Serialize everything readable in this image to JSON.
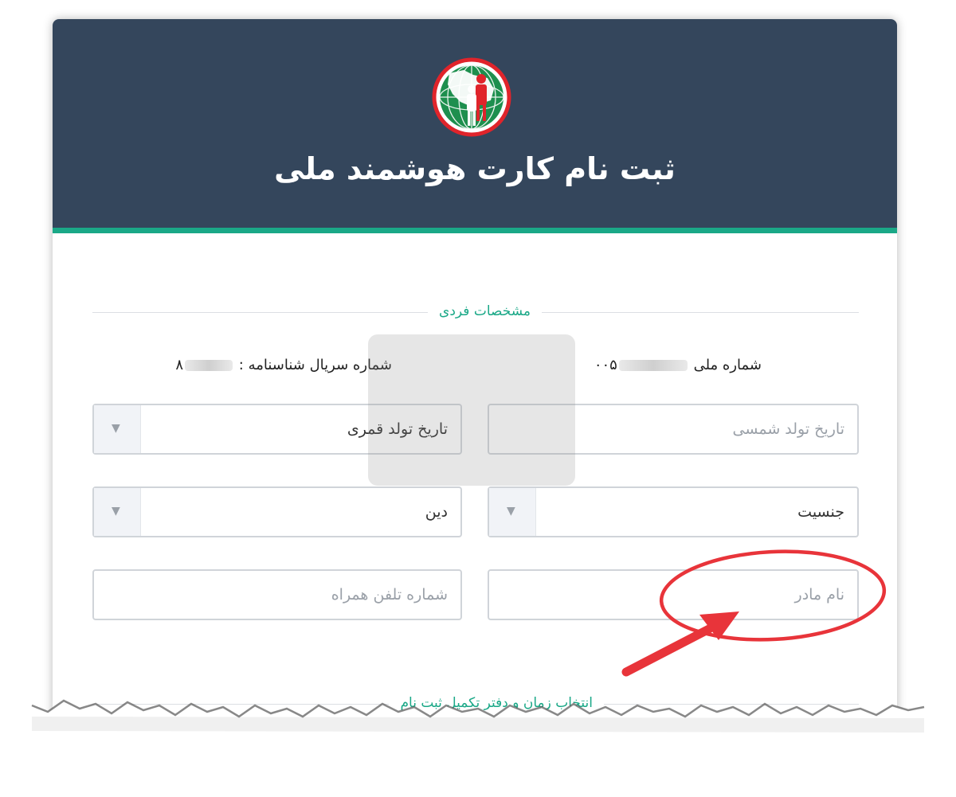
{
  "header": {
    "title": "ثبت نام کارت هوشمند ملی"
  },
  "section_personal": {
    "label": "مشخصات فردی",
    "national_code_label": "شماره ملی",
    "national_code_value": "۰۰۵",
    "serial_label": "شماره سریال شناسنامه :",
    "serial_value": "۸"
  },
  "fields": {
    "birth_shamsi_placeholder": "تاریخ تولد شمسی",
    "birth_qamari_label": "تاریخ تولد قمری",
    "gender_label": "جنسیت",
    "religion_label": "دین",
    "mother_name_placeholder": "نام مادر",
    "mobile_placeholder": "شماره تلفن همراه"
  },
  "section_schedule": {
    "label": "انتخاب زمان و دفتر تکمیل ثبت نام"
  },
  "colors": {
    "header_bg": "#34465c",
    "accent": "#1aa887",
    "annotation": "#e8343a"
  },
  "icons": {
    "dropdown": "triangle-down-icon",
    "logo": "national-id-logo"
  }
}
